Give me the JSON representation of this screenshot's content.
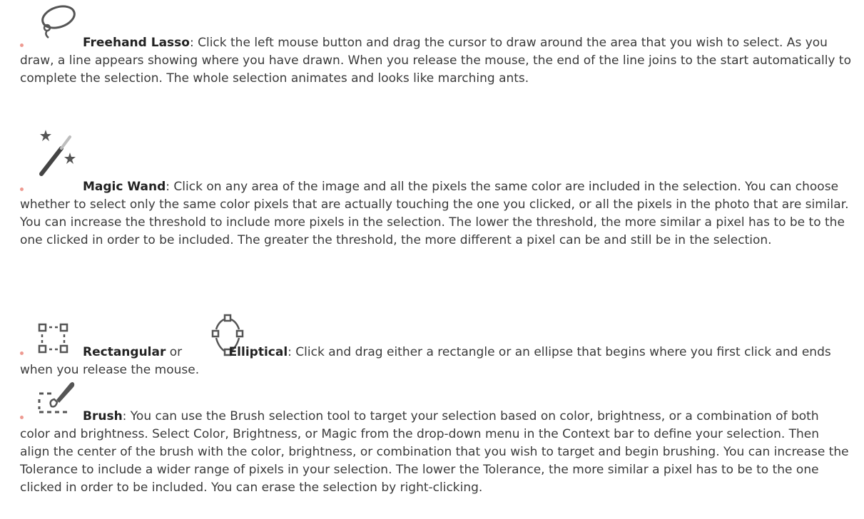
{
  "colors": {
    "bullet": "#ee9a91",
    "text": "#3a3a3a",
    "icon": "#555555"
  },
  "items": [
    {
      "icon": "lasso-icon",
      "name": "Freehand Lasso",
      "text": ": Click the left mouse button and drag the cursor to draw around the area that you wish to select. As you draw, a line appears showing where you have drawn. When you release the mouse, the end of the line joins to the start automatically to complete the selection. The whole selection animates and looks like marching ants."
    },
    {
      "icon": "magic-wand-icon",
      "name": "Magic Wand",
      "text": ": Click on any area of the image and all the pixels the same color are included in the selection. You can choose whether to select only the same color pixels that are actually touching the one you clicked, or all the pixels in the photo that are similar. You can increase the threshold to include more pixels in the selection. The lower the threshold, the more similar a pixel has to be to the one clicked in order to be included. The greater the threshold, the more different a pixel can be and still be in the selection."
    },
    {
      "icon": "rectangular-select-icon",
      "name": "Rectangular",
      "or": " or ",
      "icon2": "elliptical-select-icon",
      "name2": "Elliptical",
      "text": ": Click and drag either a rectangle or an ellipse that begins where you first click and ends when you release the mouse."
    },
    {
      "icon": "brush-select-icon",
      "name": "Brush",
      "text": ": You can use the Brush selection tool to target your selection based on color, brightness, or a combination of both color and brightness. Select Color, Brightness, or Magic from the drop-down menu in the Context bar to define your selection. Then align the center of the brush with the color, brightness, or combination that you wish to target and begin brushing. You can increase the Tolerance to include a wider range of pixels in your selection. The lower the Tolerance, the more similar a pixel has to be to the one clicked in order to be included. You can erase the selection by right-clicking."
    }
  ]
}
